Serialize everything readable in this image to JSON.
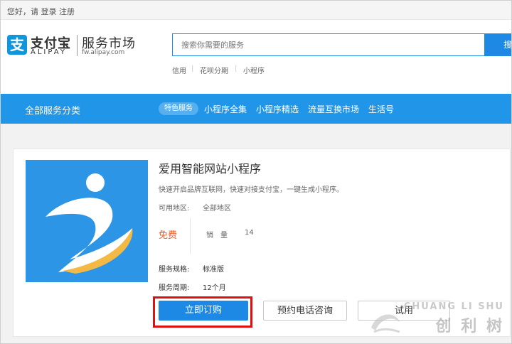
{
  "topbar": {
    "greeting": "您好，请 登录",
    "register": "注册"
  },
  "header": {
    "logo_mark": "支",
    "brand_cn": "支付宝",
    "brand_en": "ALIPAY",
    "market_title": "服务市场",
    "market_url": "fw.alipay.com"
  },
  "search": {
    "placeholder": "搜索你需要的服务",
    "button_label": "搜",
    "hot_keywords": [
      "信用",
      "花呗分期",
      "小程序"
    ]
  },
  "nav": {
    "all_categories": "全部服务分类",
    "active_item": "特色服务",
    "items": [
      "小程序全集",
      "小程序精选",
      "流量互换市场",
      "生活号"
    ]
  },
  "product": {
    "title": "爱用智能网站小程序",
    "description": "快速开启品牌互联网，快速对接支付宝，一键生成小程序。",
    "area_label": "可用地区:",
    "area_value": "全部地区",
    "price": "免费",
    "sales_label": "销　量",
    "sales_value": "14",
    "spec_label": "服务规格:",
    "spec_value": "标准版",
    "period_label": "服务周期:",
    "period_value": "12个月"
  },
  "actions": {
    "subscribe": "立即订购",
    "consult": "预约电话咨询",
    "third": "试用"
  },
  "watermark": {
    "top": "CHUANG LI SHU",
    "bottom": "创 利 树"
  },
  "colors": {
    "primary": "#1e88e5",
    "nav": "#2196e8",
    "price": "#f05a28",
    "highlight": "#e01010"
  }
}
